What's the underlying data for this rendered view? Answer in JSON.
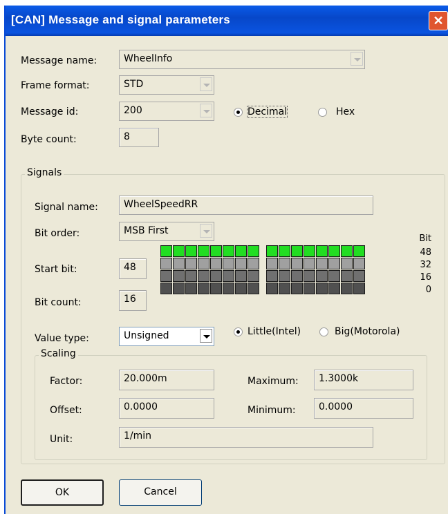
{
  "window": {
    "title": "[CAN] Message and signal parameters",
    "close_glyph": "✕"
  },
  "message": {
    "name_label": "Message name:",
    "name_value": "WheelInfo",
    "frame_label": "Frame format:",
    "frame_value": "STD",
    "id_label": "Message id:",
    "id_value": "200",
    "decimal_label": "Decimal",
    "hex_label": "Hex",
    "base_selected": "Decimal",
    "byte_label": "Byte count:",
    "byte_value": "8"
  },
  "signals": {
    "group_label": "Signals",
    "name_label": "Signal name:",
    "name_value": "WheelSpeedRR",
    "order_label": "Bit order:",
    "order_value": "MSB First",
    "start_label": "Start bit:",
    "start_value": "48",
    "count_label": "Bit count:",
    "count_value": "16",
    "bit_header": "Bit",
    "row_labels": [
      "48",
      "32",
      "16",
      "0"
    ],
    "bit_rows": [
      [
        1,
        1,
        1,
        1,
        1,
        1,
        1,
        1,
        1,
        1,
        1,
        1,
        1,
        1,
        1,
        1
      ],
      [
        0,
        0,
        0,
        0,
        0,
        0,
        0,
        0,
        0,
        0,
        0,
        0,
        0,
        0,
        0,
        0
      ],
      [
        0,
        0,
        0,
        0,
        0,
        0,
        0,
        0,
        0,
        0,
        0,
        0,
        0,
        0,
        0,
        0
      ],
      [
        0,
        0,
        0,
        0,
        0,
        0,
        0,
        0,
        0,
        0,
        0,
        0,
        0,
        0,
        0,
        0
      ]
    ],
    "row_colors": {
      "active": "#22dd22",
      "row1": "#a0a0a0",
      "row2": "#707070",
      "row3": "#505050"
    },
    "value_type_label": "Value type:",
    "value_type_value": "Unsigned",
    "little_label": "Little(Intel)",
    "big_label": "Big(Motorola)",
    "endian_selected": "Little(Intel)"
  },
  "scaling": {
    "group_label": "Scaling",
    "factor_label": "Factor:",
    "factor_value": "20.000m",
    "maximum_label": "Maximum:",
    "maximum_value": "1.3000k",
    "offset_label": "Offset:",
    "offset_value": "0.0000",
    "minimum_label": "Minimum:",
    "minimum_value": "0.0000",
    "unit_label": "Unit:",
    "unit_value": "1/min"
  },
  "buttons": {
    "ok": "OK",
    "cancel": "Cancel"
  }
}
